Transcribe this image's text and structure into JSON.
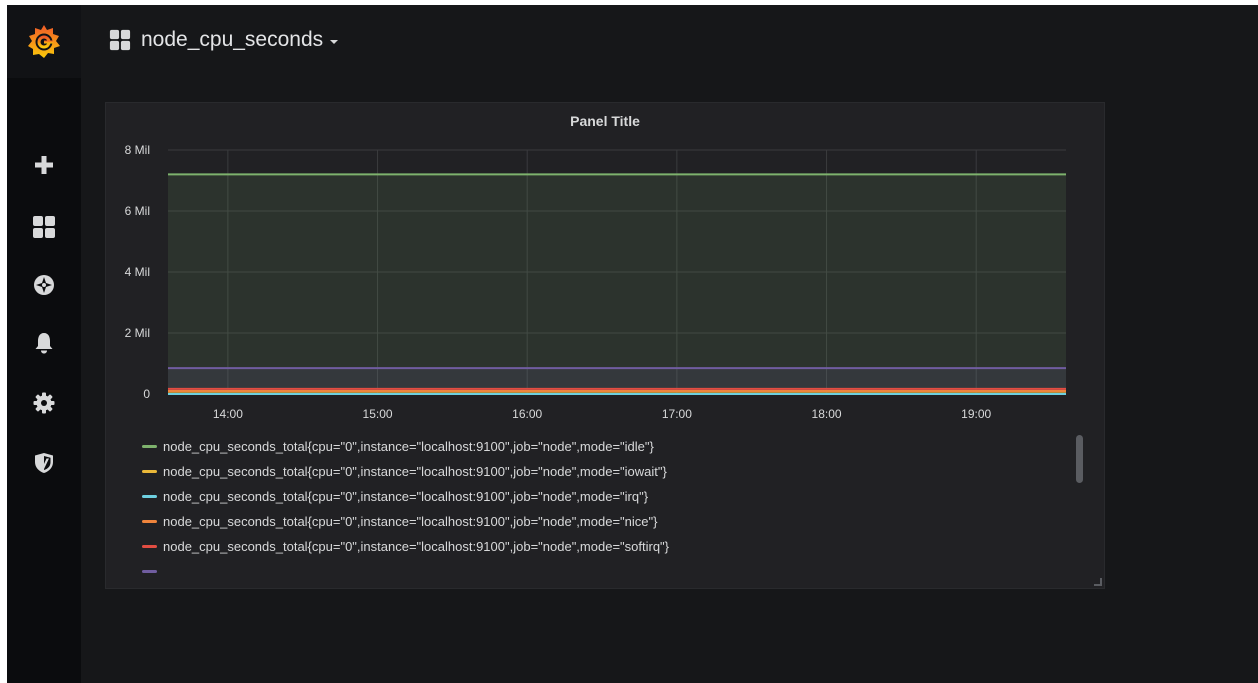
{
  "dashboard": {
    "title": "node_cpu_seconds"
  },
  "sidemenu": {
    "items": [
      {
        "icon": "plus-icon"
      },
      {
        "icon": "dashboards-icon"
      },
      {
        "icon": "compass-icon"
      },
      {
        "icon": "bell-icon"
      },
      {
        "icon": "gear-icon"
      },
      {
        "icon": "shield-icon"
      }
    ]
  },
  "panel": {
    "title": "Panel Title"
  },
  "colors": {
    "idle": "#7eb26d",
    "iowait": "#eab839",
    "irq": "#6ed0e0",
    "nice": "#ef843c",
    "softirq": "#e24d42",
    "steal": "#1f78c1",
    "system": "#ba43a9",
    "user": "#705da0"
  },
  "chart_data": {
    "type": "area",
    "title": "Panel Title",
    "xlabel": "",
    "ylabel": "",
    "x_ticks": [
      "14:00",
      "15:00",
      "16:00",
      "17:00",
      "18:00",
      "19:00"
    ],
    "y_ticks": [
      "0",
      "2 Mil",
      "4 Mil",
      "6 Mil",
      "8 Mil"
    ],
    "ylim": [
      0,
      8000000
    ],
    "xlim_hours": [
      13.6,
      19.6
    ],
    "grid": true,
    "legend": "bottom",
    "series": [
      {
        "name": "node_cpu_seconds_total{cpu=\"0\",instance=\"localhost:9100\",job=\"node\",mode=\"idle\"}",
        "color": "#7eb26d",
        "value": 7200000
      },
      {
        "name": "node_cpu_seconds_total{cpu=\"0\",instance=\"localhost:9100\",job=\"node\",mode=\"iowait\"}",
        "color": "#eab839",
        "value": 20000
      },
      {
        "name": "node_cpu_seconds_total{cpu=\"0\",instance=\"localhost:9100\",job=\"node\",mode=\"irq\"}",
        "color": "#6ed0e0",
        "value": 0
      },
      {
        "name": "node_cpu_seconds_total{cpu=\"0\",instance=\"localhost:9100\",job=\"node\",mode=\"nice\"}",
        "color": "#ef843c",
        "value": 100000
      },
      {
        "name": "node_cpu_seconds_total{cpu=\"0\",instance=\"localhost:9100\",job=\"node\",mode=\"softirq\"}",
        "color": "#e24d42",
        "value": 170000
      },
      {
        "name": "",
        "color": "#705da0",
        "value": 850000
      }
    ]
  }
}
